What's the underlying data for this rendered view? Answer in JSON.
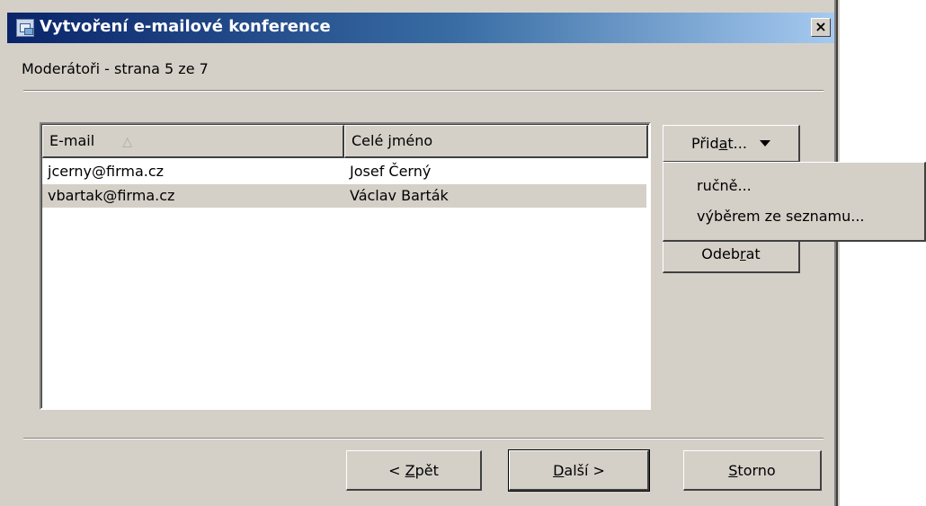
{
  "window": {
    "title": "Vytvoření e-mailové konference",
    "close_label": "×",
    "icon": "conference-app-icon"
  },
  "wizard": {
    "page_label": "Moderátoři - strana 5 ze 7"
  },
  "table": {
    "columns": [
      "E-mail",
      "Celé jméno"
    ],
    "sort_icon": "△",
    "rows": [
      {
        "email": "jcerny@firma.cz",
        "name": "Josef Černý",
        "selected": false
      },
      {
        "email": "vbartak@firma.cz",
        "name": "Václav Barták",
        "selected": true
      }
    ]
  },
  "buttons": {
    "add_pre": "Přid",
    "add_key": "a",
    "add_post": "t...",
    "remove_pre": "Odeb",
    "remove_key": "r",
    "remove_post": "at",
    "back_pre": "< ",
    "back_key": "Z",
    "back_post": "pět",
    "next_key": "D",
    "next_post": "alší >",
    "cancel_key": "S",
    "cancel_post": "torno"
  },
  "add_menu": {
    "items": [
      "ručně...",
      "výběrem ze seznamu..."
    ]
  },
  "colors": {
    "face": "#d4d0c8",
    "title_start": "#0a246a",
    "title_end": "#a6caf0"
  }
}
